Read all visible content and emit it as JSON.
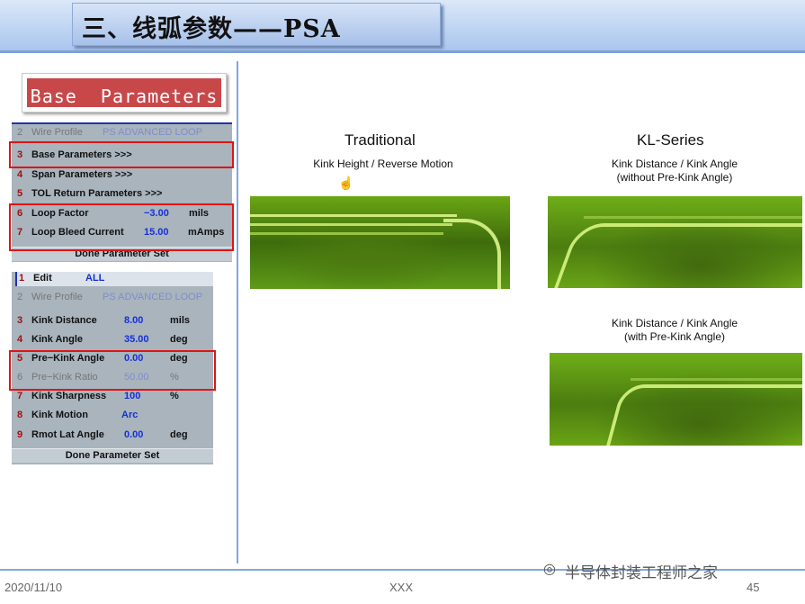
{
  "slide": {
    "title": "三、线弧参数——PSA",
    "base_button": "Base  Parameters"
  },
  "panel1": {
    "rows": [
      {
        "num": "2",
        "label": "Wire Profile",
        "value": "PS ADVANCED LOOP",
        "unit": ""
      },
      {
        "num": "3",
        "label": "Base Parameters >>>",
        "value": "",
        "unit": ""
      },
      {
        "num": "4",
        "label": "Span Parameters >>>",
        "value": "",
        "unit": ""
      },
      {
        "num": "5",
        "label": "TOL Return Parameters >>>",
        "value": "",
        "unit": ""
      },
      {
        "num": "6",
        "label": "Loop Factor",
        "value": "−3.00",
        "unit": "mils"
      },
      {
        "num": "7",
        "label": "Loop Bleed Current",
        "value": "15.00",
        "unit": "mAmps"
      }
    ],
    "done": "Done Parameter Set"
  },
  "panel2": {
    "edit": {
      "num": "1",
      "label": "Edit",
      "value": "ALL"
    },
    "rows": [
      {
        "num": "2",
        "label": "Wire Profile",
        "value": "PS ADVANCED LOOP",
        "unit": ""
      },
      {
        "num": "3",
        "label": "Kink Distance",
        "value": "8.00",
        "unit": "mils"
      },
      {
        "num": "4",
        "label": "Kink Angle",
        "value": "35.00",
        "unit": "deg"
      },
      {
        "num": "5",
        "label": "Pre−Kink Angle",
        "value": "0.00",
        "unit": "deg"
      },
      {
        "num": "6",
        "label": "Pre−Kink Ratio",
        "value": "50.00",
        "unit": "%"
      },
      {
        "num": "7",
        "label": "Kink Sharpness",
        "value": "100",
        "unit": "%"
      },
      {
        "num": "8",
        "label": "Kink Motion",
        "value": "Arc",
        "unit": ""
      },
      {
        "num": "9",
        "label": "Rmot Lat Angle",
        "value": "0.00",
        "unit": "deg"
      }
    ],
    "done": "Done Parameter Set"
  },
  "right": {
    "traditional": {
      "heading": "Traditional",
      "caption": "Kink Height / Reverse Motion"
    },
    "kl": {
      "heading": "KL-Series",
      "caption1a": "Kink Distance / Kink Angle",
      "caption1b": "(without Pre-Kink Angle)",
      "caption2a": "Kink Distance / Kink Angle",
      "caption2b": "(with Pre-Kink Angle)"
    }
  },
  "footer": {
    "date": "2020/11/10",
    "center": "XXX",
    "page": "45",
    "watermark": "半导体封装工程师之家"
  }
}
